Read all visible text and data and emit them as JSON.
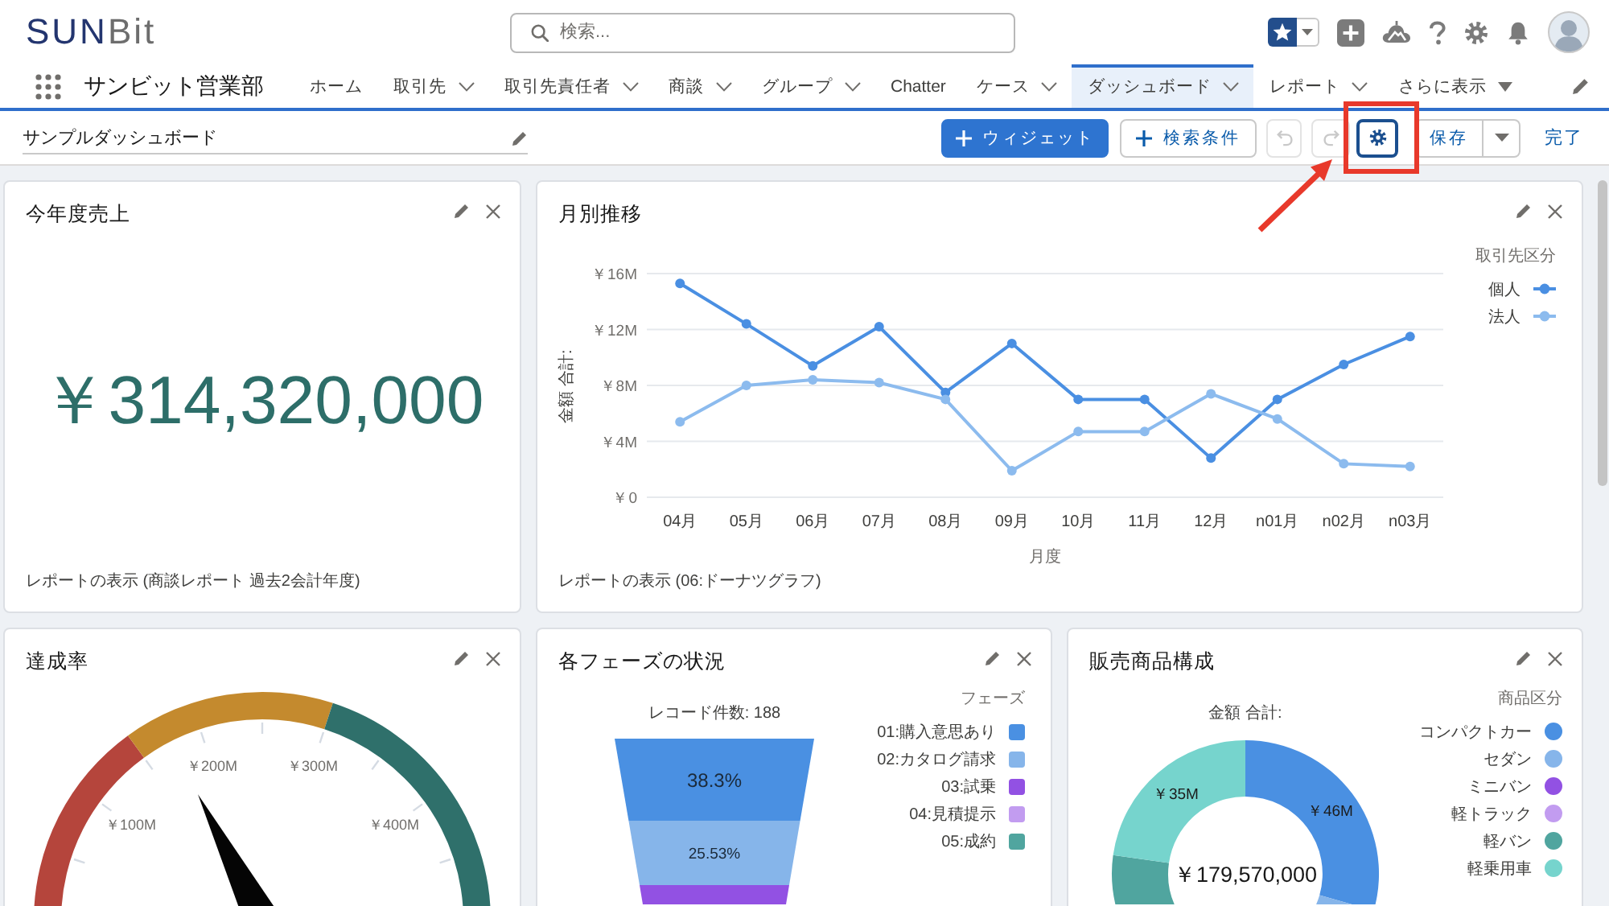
{
  "header": {
    "logo": {
      "accent": "SUN",
      "rest": "Bit"
    },
    "search": {
      "placeholder": "検索..."
    }
  },
  "nav": {
    "app_name": "サンビット営業部",
    "items": [
      {
        "label": "ホーム",
        "has_menu": false,
        "selected": false
      },
      {
        "label": "取引先",
        "has_menu": true,
        "selected": false
      },
      {
        "label": "取引先責任者",
        "has_menu": true,
        "selected": false
      },
      {
        "label": "商談",
        "has_menu": true,
        "selected": false
      },
      {
        "label": "グループ",
        "has_menu": true,
        "selected": false
      },
      {
        "label": "Chatter",
        "has_menu": false,
        "selected": false
      },
      {
        "label": "ケース",
        "has_menu": true,
        "selected": false
      },
      {
        "label": "ダッシュボード",
        "has_menu": true,
        "selected": true
      },
      {
        "label": "レポート",
        "has_menu": true,
        "selected": false
      }
    ],
    "more": {
      "label": "さらに表示"
    }
  },
  "toolbar": {
    "title": "サンプルダッシュボード",
    "widget_button": {
      "label": "ウィジェット"
    },
    "filter_button": {
      "label": "検索条件"
    },
    "undo_button": {
      "disabled": true
    },
    "redo_button": {
      "disabled": true
    },
    "settings_button": {
      "focused": true
    },
    "save_button": {
      "label": "保存"
    },
    "done_link": {
      "label": "完了"
    }
  },
  "widgets": [
    {
      "kind": "metric",
      "title": "今年度売上",
      "value": "￥314,320,000",
      "footer": "レポートの表示 (商談レポート 過去2会計年度)"
    },
    {
      "kind": "line",
      "title": "月別推移",
      "legend_title": "取引先区分",
      "chart_data": {
        "type": "line",
        "xlabel": "月度",
        "ylabel": "金額 合計:",
        "categories": [
          "04月",
          "05月",
          "06月",
          "07月",
          "08月",
          "09月",
          "10月",
          "11月",
          "12月",
          "n01月",
          "n02月",
          "n03月"
        ],
        "series": [
          {
            "name": "個人",
            "color": "#4a8fe2",
            "marker": "circle",
            "values": [
              15.3,
              12.4,
              9.4,
              12.2,
              7.5,
              11.0,
              7.0,
              7.0,
              2.8,
              7.0,
              9.5,
              11.5
            ]
          },
          {
            "name": "法人",
            "color": "#8cbbee",
            "marker": "circle",
            "values": [
              5.4,
              8.0,
              8.4,
              8.2,
              7.0,
              1.9,
              4.7,
              4.7,
              7.4,
              5.6,
              2.4,
              2.2
            ]
          }
        ],
        "ylim": [
          0,
          16
        ],
        "yticks": [
          {
            "value": 0,
            "label": "￥0"
          },
          {
            "value": 4,
            "label": "￥4M"
          },
          {
            "value": 8,
            "label": "￥8M"
          },
          {
            "value": 12,
            "label": "￥12M"
          },
          {
            "value": 16,
            "label": "￥16M"
          }
        ],
        "grid": true
      },
      "footer": "レポートの表示 (06:ドーナツグラフ)"
    },
    {
      "kind": "gauge",
      "title": "達成率",
      "gauge": {
        "tick_labels": [
          "￥100M",
          "￥200M",
          "￥300M",
          "￥400M"
        ]
      }
    },
    {
      "kind": "funnel",
      "title": "各フェーズの状況",
      "record_count": "レコード件数: 188",
      "segments": [
        {
          "label": "38.3%",
          "color": "#4a90e2"
        },
        {
          "label": "25.53%",
          "color": "#86b5ea"
        },
        {
          "color": "#9251e3"
        }
      ],
      "legend_title": "フェーズ",
      "legend": [
        {
          "label": "01:購入意思あり",
          "color": "#4a90e2"
        },
        {
          "label": "02:カタログ請求",
          "color": "#86b5ea"
        },
        {
          "label": "03:試乗",
          "color": "#9251e3"
        },
        {
          "label": "04:見積提示",
          "color": "#c29cf0"
        },
        {
          "label": "05:成約",
          "color": "#50a59f"
        }
      ]
    },
    {
      "kind": "donut",
      "title": "販売商品構成",
      "total_label": "金額 合計:",
      "total": "￥179,570,000",
      "slices": [
        {
          "label": "￥46M",
          "color": "#4a90e2"
        },
        {
          "color": "#86b5ea"
        },
        {
          "color": "#50a59f"
        },
        {
          "label": "￥35M",
          "color": "#76d4cd"
        }
      ],
      "legend_title": "商品区分",
      "legend": [
        {
          "label": "コンパクトカー",
          "color": "#4a90e2"
        },
        {
          "label": "セダン",
          "color": "#86b5ea"
        },
        {
          "label": "ミニバン",
          "color": "#9251e3"
        },
        {
          "label": "軽トラック",
          "color": "#c29cf0"
        },
        {
          "label": "軽バン",
          "color": "#50a59f"
        },
        {
          "label": "軽乗用車",
          "color": "#76d4cd"
        }
      ]
    }
  ]
}
